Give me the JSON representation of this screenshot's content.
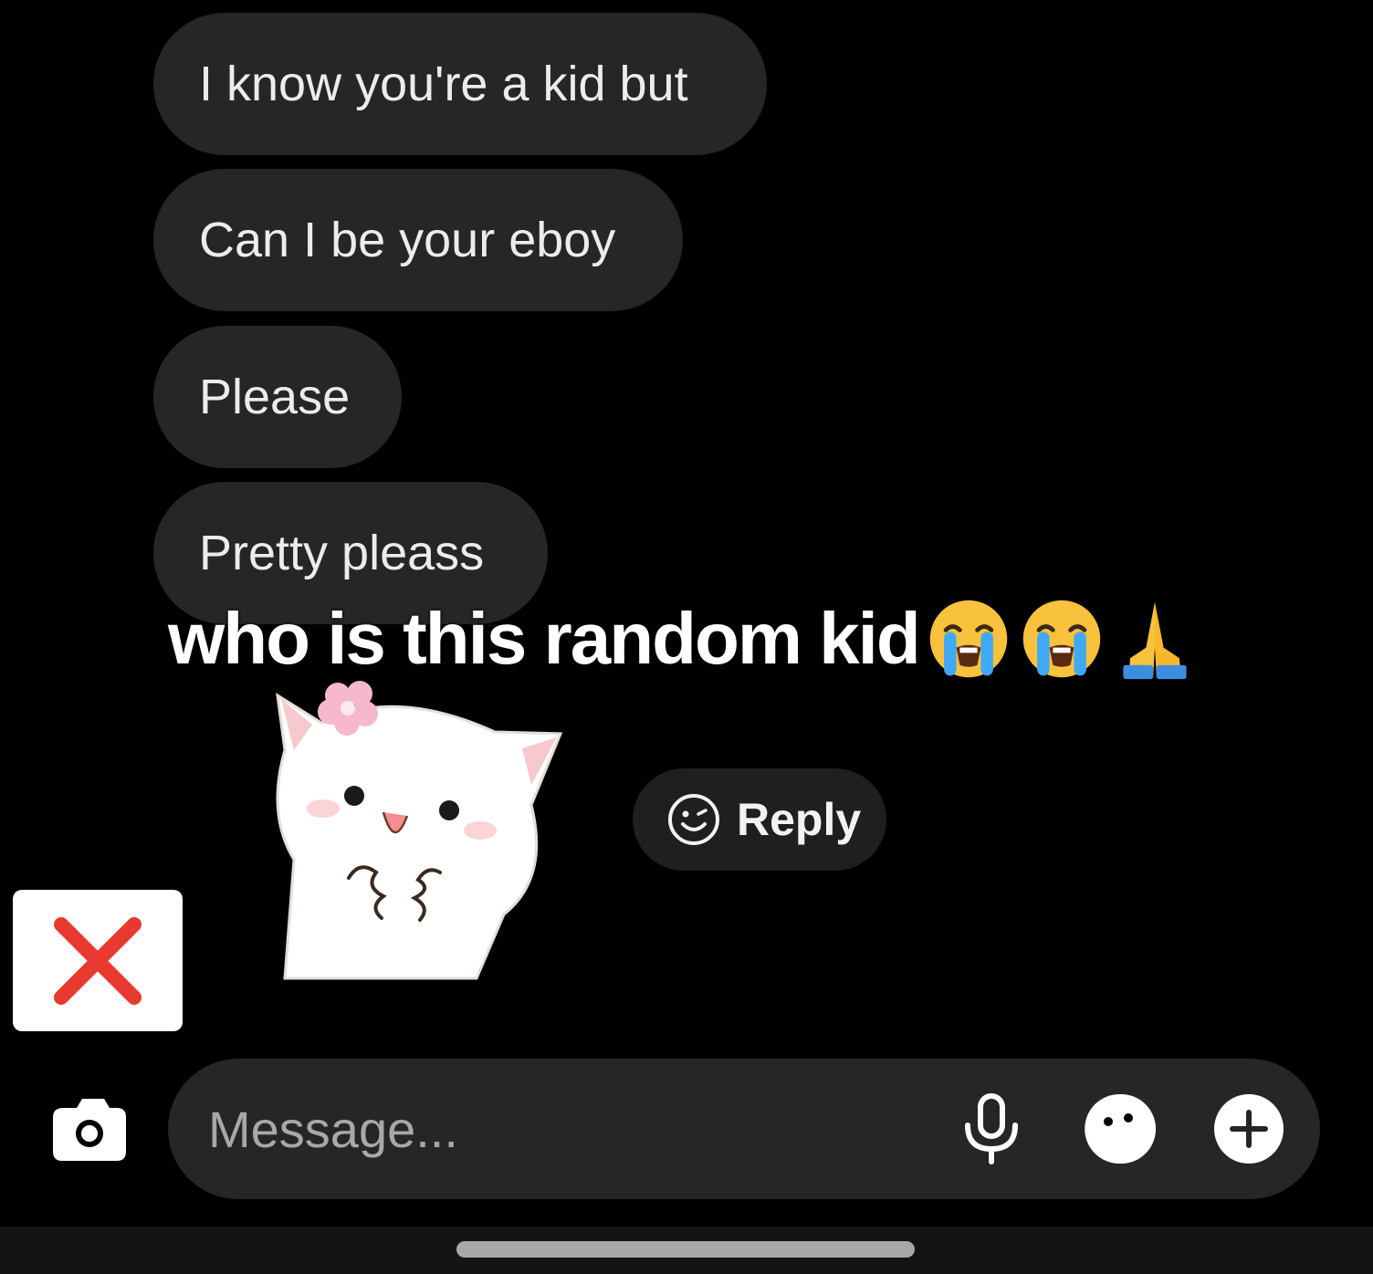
{
  "messages": [
    {
      "text": "I know you're a kid but"
    },
    {
      "text": "Can I be your eboy"
    },
    {
      "text": "Please"
    },
    {
      "text": "Pretty pleass"
    }
  ],
  "overlay_caption": {
    "text": "who is this random kid",
    "emojis": [
      "loudly-crying-face",
      "loudly-crying-face",
      "folded-hands"
    ]
  },
  "sticker": {
    "name": "white-cat-sticker"
  },
  "reply_button": {
    "label": "Reply",
    "icon": "smiley-face-icon"
  },
  "close_box": {
    "icon": "red-x-icon",
    "color": "#e8392f"
  },
  "composer": {
    "placeholder": "Message...",
    "icons": [
      "camera-icon",
      "microphone-icon",
      "sticker-icon",
      "plus-icon"
    ]
  },
  "colors": {
    "background": "#000000",
    "bubble": "#262626",
    "placeholder": "#a8a8a8"
  }
}
